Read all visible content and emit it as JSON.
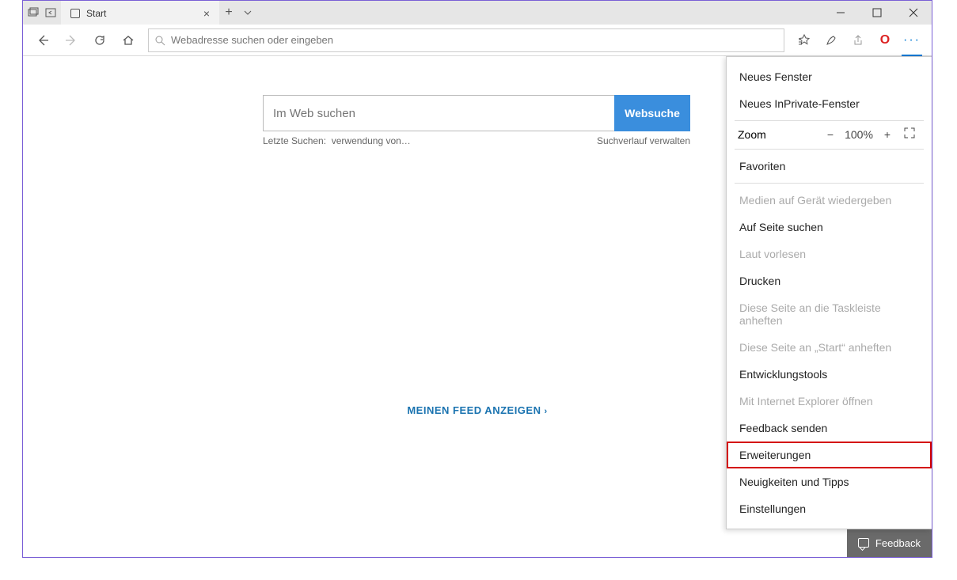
{
  "tab": {
    "title": "Start"
  },
  "address_bar": {
    "placeholder": "Webadresse suchen oder eingeben"
  },
  "search": {
    "placeholder": "Im Web suchen",
    "button": "Websuche",
    "last_label": "Letzte Suchen:",
    "last_query": "verwendung von…",
    "history_link": "Suchverlauf verwalten"
  },
  "feed_link": "MEINEN FEED ANZEIGEN",
  "menu": {
    "new_window": "Neues Fenster",
    "new_inprivate": "Neues InPrivate-Fenster",
    "zoom_label": "Zoom",
    "zoom_value": "100%",
    "favorites": "Favoriten",
    "cast": "Medien auf Gerät wiedergeben",
    "find": "Auf Seite suchen",
    "read_aloud": "Laut vorlesen",
    "print": "Drucken",
    "pin_taskbar": "Diese Seite an die Taskleiste anheften",
    "pin_start": "Diese Seite an „Start“ anheften",
    "devtools": "Entwicklungstools",
    "open_ie": "Mit Internet Explorer öffnen",
    "send_feedback": "Feedback senden",
    "extensions": "Erweiterungen",
    "news_tips": "Neuigkeiten und Tipps",
    "settings": "Einstellungen"
  },
  "feedback_button": "Feedback"
}
